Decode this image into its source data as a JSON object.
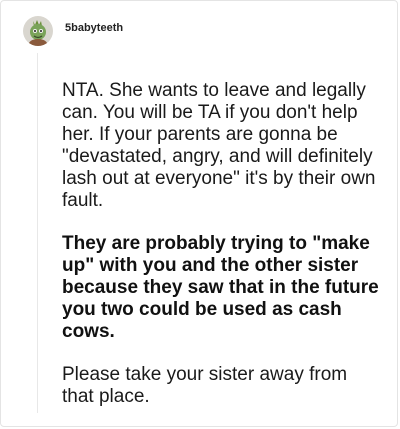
{
  "post": {
    "username": "5babyteeth",
    "avatar_icon": "zombie-avatar-icon",
    "paragraphs": [
      "NTA. She wants to leave and legally can. You will be TA if you don't help her. If your parents are gonna be \"devastated, angry, and will definitely lash out at everyone\" it's by their own fault.",
      "They are probably trying to \"make up\" with you and the other sister because they saw that in the future you two could be used as cash cows.",
      "Please take your sister away from that place."
    ]
  }
}
